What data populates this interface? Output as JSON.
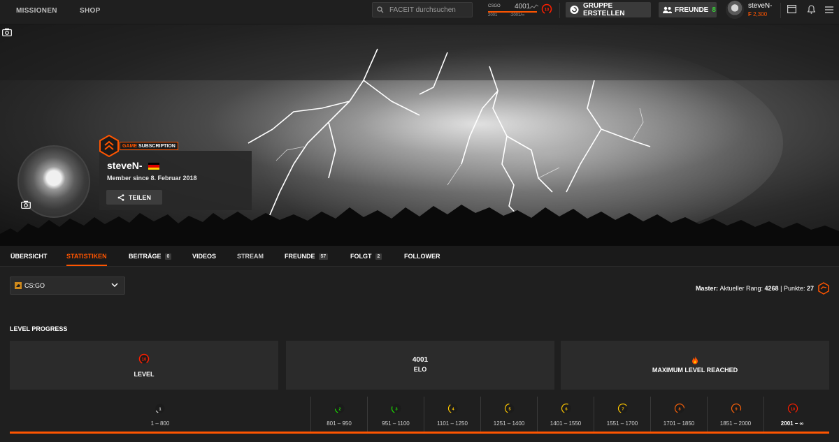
{
  "nav": {
    "missions": "MISSIONEN",
    "shop": "SHOP"
  },
  "search": {
    "placeholder": "FACEIT durchsuchen"
  },
  "elo_widget": {
    "game": "CSGO",
    "elo": "4001",
    "range_low": "2001",
    "range_high": "-2001/∞",
    "level": "10"
  },
  "header": {
    "create_group": "GRUPPE ERSTELLEN",
    "friends_label": "FREUNDE",
    "friends_count": "8",
    "username": "steveN-",
    "points": "2,300"
  },
  "profile": {
    "subscription_a": "GAME",
    "subscription_b": "SUBSCRIPTION",
    "nickname": "steveN-",
    "member_since": "Member since 8. Februar 2018",
    "share": "TEILEN"
  },
  "tabs": [
    {
      "label": "ÜBERSICHT"
    },
    {
      "label": "STATISTIKEN",
      "active": true
    },
    {
      "label": "BEITRÄGE",
      "count": "0"
    },
    {
      "label": "VIDEOS"
    },
    {
      "label": "STREAM"
    },
    {
      "label": "FREUNDE",
      "count": "57"
    },
    {
      "label": "FOLGT",
      "count": "2"
    },
    {
      "label": "FOLLOWER"
    }
  ],
  "game_select": {
    "value": "CS:GO"
  },
  "master": {
    "title": "Master:",
    "rank_label": "Aktueller Rang:",
    "rank": "4268",
    "sep": "|",
    "points_label": "Punkte:",
    "points": "27"
  },
  "level_progress": {
    "title": "LEVEL PROGRESS",
    "level_label": "LEVEL",
    "level_value": "10",
    "elo_value": "4001",
    "elo_label": "ELO",
    "max_label": "MAXIMUM LEVEL REACHED",
    "progress_fraction": 1.0,
    "levels": [
      {
        "level": "1",
        "range": "1 – 800",
        "color": "#e8e8e8"
      },
      {
        "level": "2",
        "range": "801 – 950",
        "color": "#1ce400"
      },
      {
        "level": "3",
        "range": "951 – 1100",
        "color": "#1ce400"
      },
      {
        "level": "4",
        "range": "1101 – 1250",
        "color": "#ffc800"
      },
      {
        "level": "5",
        "range": "1251 – 1400",
        "color": "#ffc800"
      },
      {
        "level": "6",
        "range": "1401 – 1550",
        "color": "#ffc800"
      },
      {
        "level": "7",
        "range": "1551 – 1700",
        "color": "#ffc800"
      },
      {
        "level": "8",
        "range": "1701 – 1850",
        "color": "#ff6309"
      },
      {
        "level": "9",
        "range": "1851 – 2000",
        "color": "#ff6309"
      },
      {
        "level": "10",
        "range": "2001 – ∞",
        "color": "#fe1f00"
      }
    ]
  },
  "colors": {
    "accent": "#ff5500",
    "level10": "#fe1f00",
    "online": "#39d239"
  }
}
